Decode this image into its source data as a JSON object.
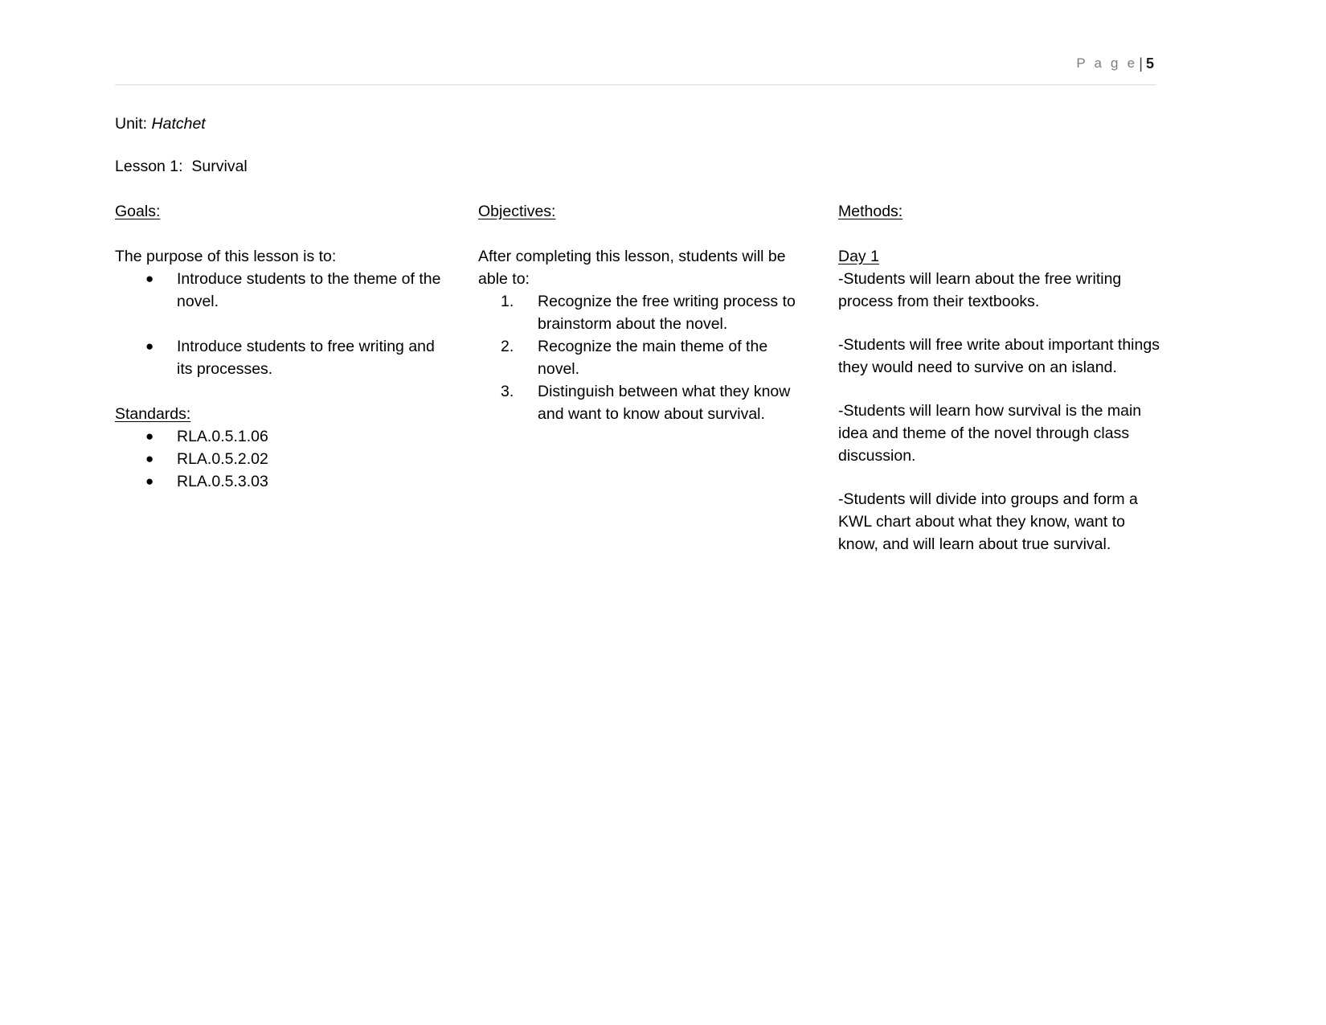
{
  "header": {
    "page_word": "P a g e",
    "separator": "|",
    "page_number": "5"
  },
  "document": {
    "unit_label": "Unit: ",
    "unit_title": "Hatchet",
    "lesson_line": "Lesson 1:  Survival"
  },
  "goals": {
    "heading": "Goals:",
    "intro": "The purpose of this lesson is to:",
    "items": [
      "Introduce students to the theme of the novel.",
      "Introduce students to free writing and its processes."
    ],
    "bullet_glyph": "●"
  },
  "standards": {
    "heading": "Standards:",
    "items": [
      "RLA.0.5.1.06",
      "RLA.0.5.2.02",
      "RLA.0.5.3.03"
    ],
    "bullet_glyph": "●"
  },
  "objectives": {
    "heading": "Objectives:",
    "intro": "After completing this lesson, students will be able to:",
    "items": [
      "Recognize the free writing process to brainstorm about the novel.",
      "Recognize the main theme of the novel.",
      "Distinguish between what they know and want to know about survival."
    ],
    "markers": [
      "1.",
      "2.",
      "3."
    ]
  },
  "methods": {
    "heading": "Methods:",
    "day_label": "Day 1",
    "blocks": [
      "-Students will learn about the free writing process from their textbooks.",
      "-Students will free write about important things they would need to survive on an island.",
      "-Students will learn how survival is the main idea and theme of the novel through class discussion.",
      "-Students will divide into groups and form a KWL chart about what they know, want to know, and will learn about true survival."
    ]
  }
}
